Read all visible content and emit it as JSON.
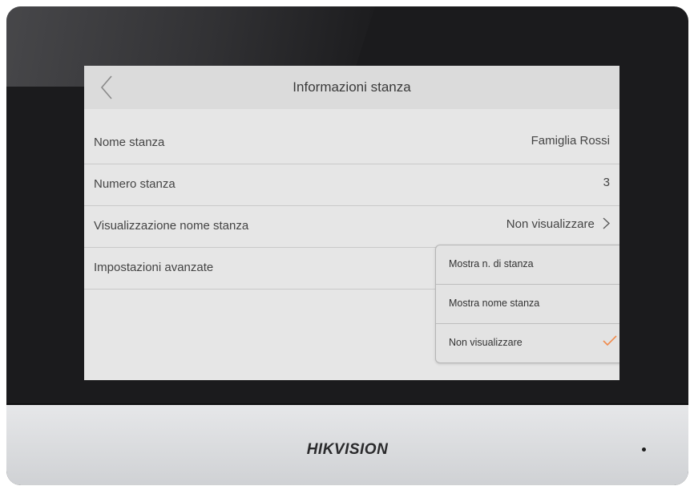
{
  "header": {
    "title": "Informazioni stanza",
    "back_icon": "chevron-left-icon"
  },
  "rows": [
    {
      "label": "Nome stanza",
      "value": "Famiglia Rossi"
    },
    {
      "label": "Numero stanza",
      "value": "3"
    },
    {
      "label": "Visualizzazione nome stanza",
      "value": "Non visualizzare"
    },
    {
      "label": "Impostazioni avanzate"
    }
  ],
  "dropdown": {
    "options": [
      {
        "label": "Mostra n. di stanza"
      },
      {
        "label": "Mostra nome stanza"
      },
      {
        "label": "Non visualizzare"
      }
    ],
    "selected_index": 2,
    "check_color": "#f08a4b"
  },
  "device": {
    "brand": "HIKVISION"
  }
}
